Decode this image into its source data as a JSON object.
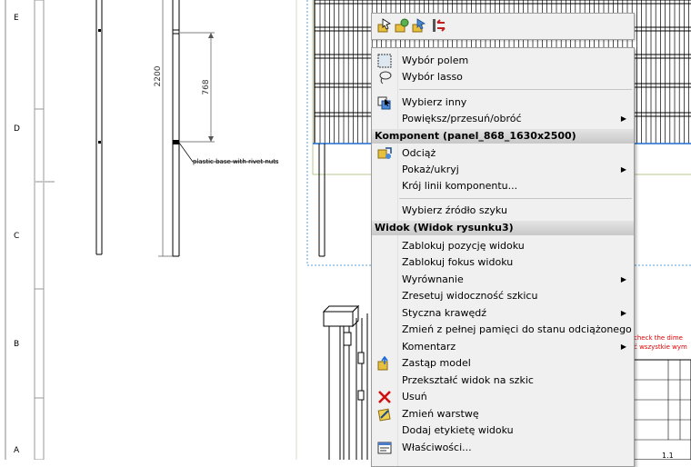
{
  "drawing": {
    "zone_labels": [
      "E",
      "D",
      "C",
      "B",
      "A"
    ],
    "dimension_2200": "2200",
    "dimension_768": "768",
    "callout_text": "plastic base with rivet nuts",
    "note_line1": "check the dime",
    "note_line2": "ć wszystkie wym",
    "sheet_fragment": "1.1"
  },
  "menu": {
    "items": [
      {
        "label": "Wybór polem",
        "icon": "box-select-icon"
      },
      {
        "label": "Wybór lasso",
        "icon": "lasso-icon"
      },
      {
        "label": "Wybierz inny",
        "icon": "select-other-icon"
      },
      {
        "label": "Powiększ/przesuń/obróć",
        "submenu": true
      },
      {
        "label": "Odciąż",
        "icon": "lightweight-icon"
      },
      {
        "label": "Pokaż/ukryj",
        "submenu": true
      },
      {
        "label": "Krój linii komponentu..."
      },
      {
        "label": "Wybierz źródło szyku"
      },
      {
        "label": "Zablokuj pozycję widoku"
      },
      {
        "label": "Zablokuj fokus widoku"
      },
      {
        "label": "Wyrównanie",
        "submenu": true
      },
      {
        "label": "Zresetuj widoczność szkicu"
      },
      {
        "label": "Styczna krawędź",
        "submenu": true
      },
      {
        "label": "Zmień z pełnej pamięci do stanu odciążonego"
      },
      {
        "label": "Komentarz",
        "submenu": true
      },
      {
        "label": "Zastąp model",
        "icon": "replace-model-icon"
      },
      {
        "label": "Przekształć widok na szkic"
      },
      {
        "label": "Usuń",
        "icon": "delete-icon"
      },
      {
        "label": "Zmień warstwę",
        "icon": "layer-icon"
      },
      {
        "label": "Dodaj etykietę widoku"
      },
      {
        "label": "Właściwości...",
        "icon": "properties-icon"
      }
    ],
    "headers": [
      {
        "label": "Komponent (panel_868_1630x2500)"
      },
      {
        "label": "Widok (Widok rysunku3)"
      }
    ]
  },
  "colors": {
    "menu_bg": "#f0f0f0",
    "header_bg": "#d0d0d0",
    "annotation_red": "#e00000",
    "selection_blue": "#1e6fd0",
    "drawing_line": "#000000",
    "delete_red": "#d01010"
  }
}
